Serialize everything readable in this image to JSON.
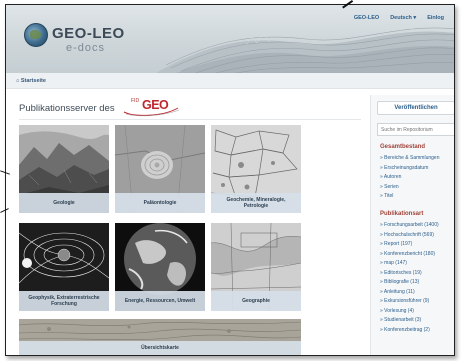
{
  "header": {
    "logo_title": "GEO-LEO",
    "logo_sub": "e-docs",
    "nav": [
      "GEO-LEO",
      "Deutsch ▾",
      "Einlog"
    ]
  },
  "breadcrumb": {
    "home_label": "Startseite"
  },
  "page": {
    "title": "Publikationsserver des",
    "fid_small": "FID",
    "fid_big": "GEO"
  },
  "tiles": [
    {
      "label": "Geologie"
    },
    {
      "label": "Paläontologie"
    },
    {
      "label": "Geochemie, Mineralogie, Petrologie"
    },
    {
      "label": "Geophysik, Extraterrestrische Forschung"
    },
    {
      "label": "Energie, Ressourcen, Umwelt"
    },
    {
      "label": "Geographie"
    }
  ],
  "wide_tile": {
    "label": "Übersichtskarte"
  },
  "sidebar": {
    "publish_label": "Veröffentlichen",
    "search_placeholder": "Suche im Repositorium",
    "section1_title": "Gesamtbestand",
    "section1_items": [
      "Bereiche & Sammlungen",
      "Erscheinungsdatum",
      "Autoren",
      "Serien",
      "Titel"
    ],
    "section2_title": "Publikationsart",
    "section2_items": [
      "Forschungsarbeit (1400)",
      "Hochschulschrift (569)",
      "Report (197)",
      "Konferenzbericht (180)",
      "map (147)",
      "Editorisches (19)",
      "Bibliografie (13)",
      "Anleitung (11)",
      "Exkursionsführer (9)",
      "Vorlesung (4)",
      "Studienarbeit (3)",
      "Konferenzbeitrag (2)"
    ]
  },
  "colors": {
    "link": "#2b5e8c",
    "section_heading": "#a0433a",
    "fid_red": "#c0262b",
    "caption_bg": "#d6e0e8"
  }
}
